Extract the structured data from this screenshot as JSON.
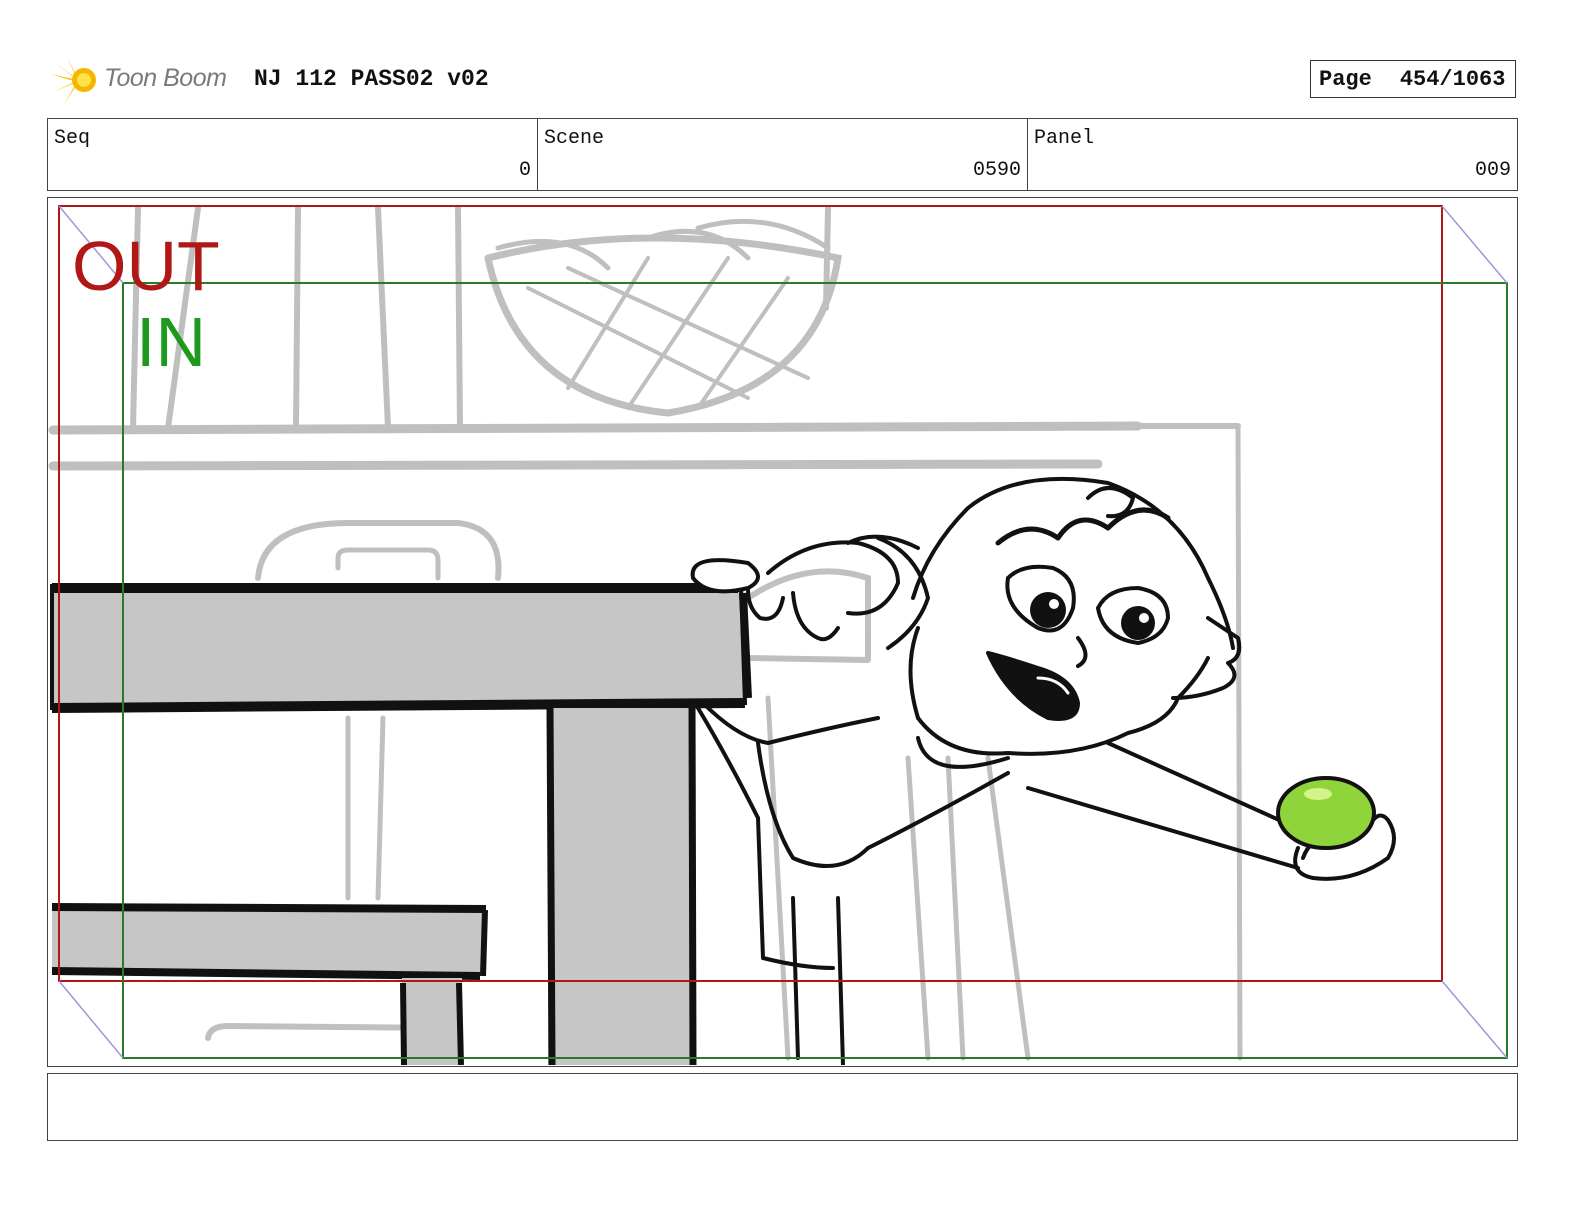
{
  "header": {
    "logo_text": "Toon Boom",
    "title": "NJ 112 PASS02 v02",
    "page_label": "Page",
    "page_value": "454/1063"
  },
  "info": {
    "seq_label": "Seq",
    "seq_value": "0",
    "scene_label": "Scene",
    "scene_value": "0590",
    "panel_label": "Panel",
    "panel_value": "009"
  },
  "panel": {
    "out_label": "OUT",
    "in_label": "IN",
    "out_color": "#b01818",
    "in_color": "#1d9a1d",
    "apple_color": "#8fd43a"
  },
  "notes": {
    "text": ""
  }
}
